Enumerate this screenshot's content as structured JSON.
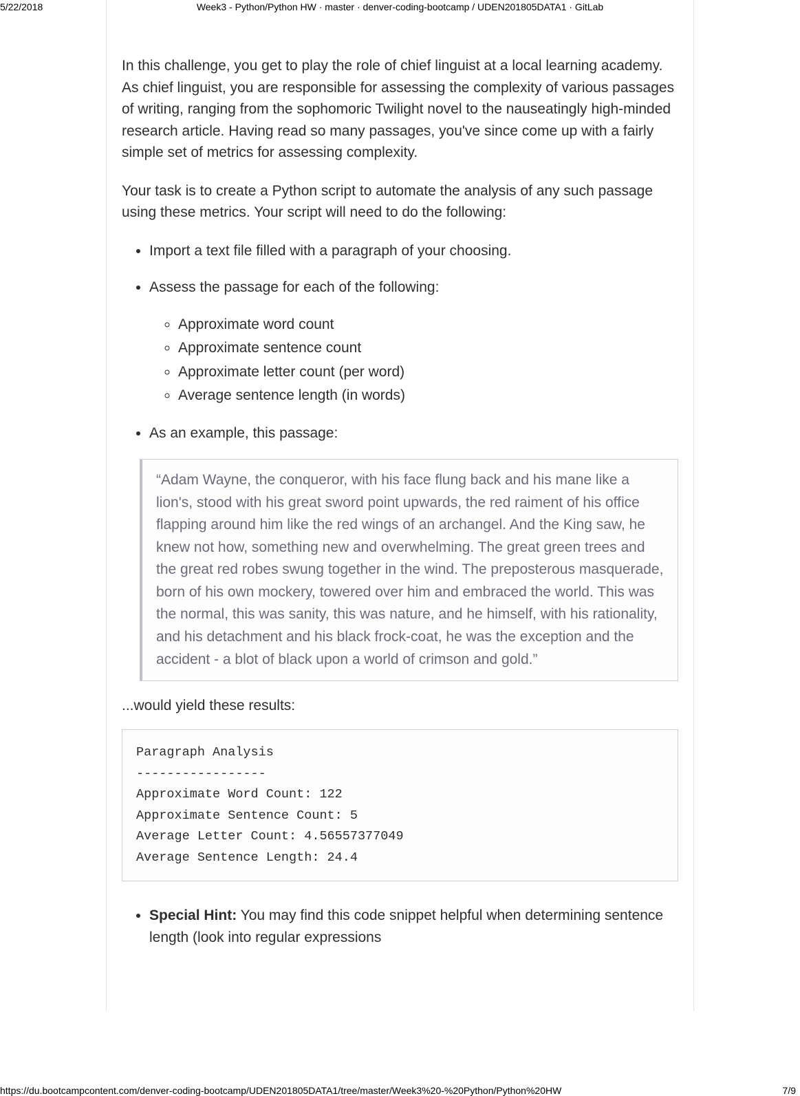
{
  "print": {
    "date": "5/22/2018",
    "header_title": "Week3 - Python/Python HW · master · denver-coding-bootcamp / UDEN201805DATA1 · GitLab",
    "footer_url": "https://du.bootcampcontent.com/denver-coding-bootcamp/UDEN201805DATA1/tree/master/Week3%20-%20Python/Python%20HW",
    "page_num": "7/9"
  },
  "intro1": "In this challenge, you get to play the role of chief linguist at a local learning academy. As chief linguist, you are responsible for assessing the complexity of various passages of writing, ranging from the sophomoric Twilight novel to the nauseatingly high-minded research article. Having read so many passages, you've since come up with a fairly simple set of metrics for assessing complexity.",
  "intro2": "Your task is to create a Python script to automate the analysis of any such passage using these metrics. Your script will need to do the following:",
  "bullets": {
    "b1": "Import a text file filled with a paragraph of your choosing.",
    "b2": "Assess the passage for each of the following:",
    "sub": {
      "s1": "Approximate word count",
      "s2": "Approximate sentence count",
      "s3": "Approximate letter count (per word)",
      "s4": "Average sentence length (in words)"
    },
    "b3": "As an example, this passage:"
  },
  "quote": "“Adam Wayne, the conqueror, with his face flung back and his mane like a lion's, stood with his great sword point upwards, the red raiment of his office flapping around him like the red wings of an archangel. And the King saw, he knew not how, something new and overwhelming. The great green trees and the great red robes swung together in the wind. The preposterous masquerade, born of his own mockery, towered over him and embraced the world. This was the normal, this was sanity, this was nature, and he himself, with his rationality, and his detachment and his black frock-coat, he was the exception and the accident - a blot of black upon a world of crimson and gold.”",
  "results_label": "...would yield these results:",
  "code": "Paragraph Analysis\n-----------------\nApproximate Word Count: 122\nApproximate Sentence Count: 5\nAverage Letter Count: 4.56557377049\nAverage Sentence Length: 24.4",
  "hint": {
    "label": "Special Hint:",
    "text": " You may find this code snippet helpful when determining sentence length (look into regular expressions"
  }
}
